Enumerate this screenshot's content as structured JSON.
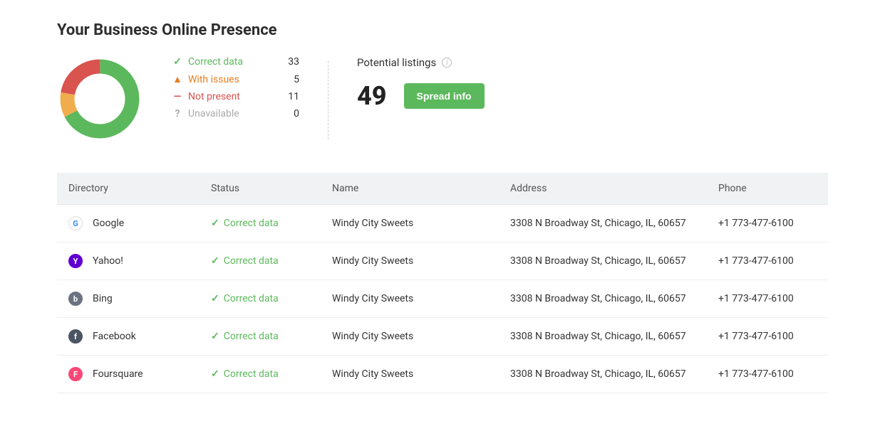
{
  "title": "Your Business Online Presence",
  "chart_data": {
    "type": "pie",
    "title": "",
    "categories": [
      "Correct data",
      "With issues",
      "Not present",
      "Unavailable"
    ],
    "values": [
      33,
      5,
      11,
      0
    ],
    "colors": [
      "#5cb85c",
      "#f0ad4e",
      "#d9534f",
      "#cccccc"
    ]
  },
  "legend": [
    {
      "icon": "✓",
      "label": "Correct data",
      "value": 33,
      "color_class": "c-green"
    },
    {
      "icon": "▲",
      "label": "With issues",
      "value": 5,
      "color_class": "c-orange"
    },
    {
      "icon": "—",
      "label": "Not present",
      "value": 11,
      "color_class": "c-red"
    },
    {
      "icon": "?",
      "label": "Unavailable",
      "value": 0,
      "color_class": "c-gray"
    }
  ],
  "potential": {
    "label": "Potential listings",
    "count": 49,
    "button": "Spread info"
  },
  "table": {
    "headers": [
      "Directory",
      "Status",
      "Name",
      "Address",
      "Phone"
    ],
    "rows": [
      {
        "directory": "Google",
        "icon_bg": "#ffffff",
        "icon_fg": "#4285F4",
        "icon_letter": "G",
        "icon_border": "#ddd",
        "status": "Correct data",
        "name": "Windy City Sweets",
        "address": "3308 N Broadway St, Chicago, IL, 60657",
        "phone": "+1 773-477-6100"
      },
      {
        "directory": "Yahoo!",
        "icon_bg": "#5f01d1",
        "icon_fg": "#ffffff",
        "icon_letter": "Y",
        "icon_border": "#5f01d1",
        "status": "Correct data",
        "name": "Windy City Sweets",
        "address": "3308 N Broadway St, Chicago, IL, 60657",
        "phone": "+1 773-477-6100"
      },
      {
        "directory": "Bing",
        "icon_bg": "#6b7280",
        "icon_fg": "#ffffff",
        "icon_letter": "b",
        "icon_border": "#6b7280",
        "status": "Correct data",
        "name": "Windy City Sweets",
        "address": "3308 N Broadway St, Chicago, IL, 60657",
        "phone": "+1 773-477-6100"
      },
      {
        "directory": "Facebook",
        "icon_bg": "#4b5563",
        "icon_fg": "#ffffff",
        "icon_letter": "f",
        "icon_border": "#4b5563",
        "status": "Correct data",
        "name": "Windy City Sweets",
        "address": "3308 N Broadway St, Chicago, IL, 60657",
        "phone": "+1 773-477-6100"
      },
      {
        "directory": "Foursquare",
        "icon_bg": "#F94877",
        "icon_fg": "#ffffff",
        "icon_letter": "F",
        "icon_border": "#F94877",
        "status": "Correct data",
        "name": "Windy City Sweets",
        "address": "3308 N Broadway St, Chicago, IL, 60657",
        "phone": "+1 773-477-6100"
      }
    ]
  }
}
